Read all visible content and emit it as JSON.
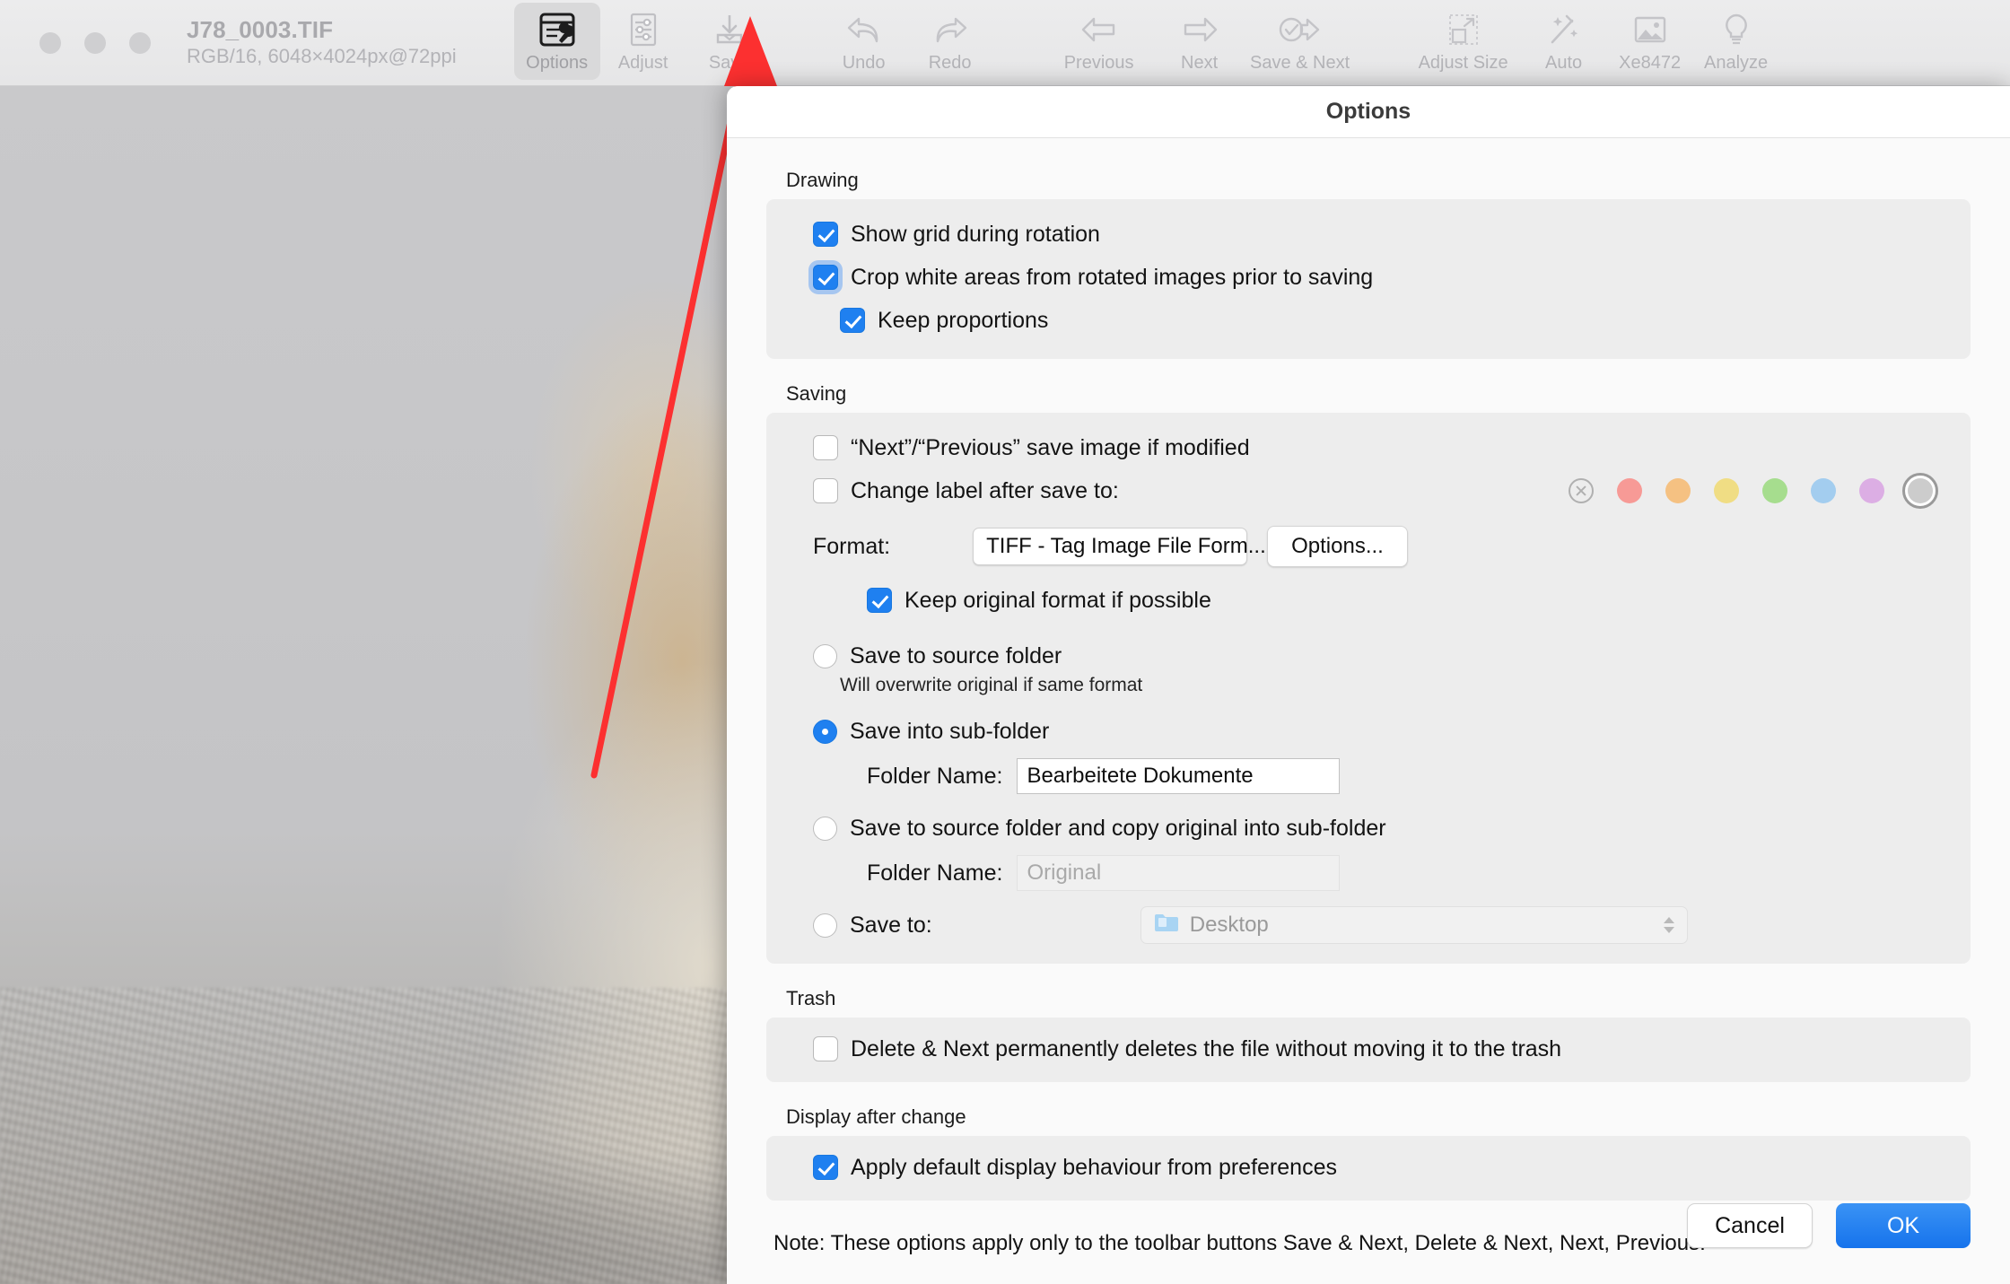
{
  "window": {
    "file_name": "J78_0003.TIF",
    "file_meta": "RGB/16, 6048×4024px@72ppi"
  },
  "toolbar": {
    "items": [
      {
        "label": "Options",
        "icon": "options-wrench-icon",
        "active": true
      },
      {
        "label": "Adjust",
        "icon": "sliders-icon",
        "active": false
      },
      {
        "label": "Save",
        "icon": "save-download-icon",
        "active": false
      },
      {
        "label": "Undo",
        "icon": "undo-arrow-icon",
        "active": false
      },
      {
        "label": "Redo",
        "icon": "redo-arrow-icon",
        "active": false
      },
      {
        "label": "Previous",
        "icon": "arrow-left-icon",
        "active": false
      },
      {
        "label": "Next",
        "icon": "arrow-right-icon",
        "active": false
      },
      {
        "label": "Save & Next",
        "icon": "check-arrow-icon",
        "active": false
      },
      {
        "label": "Adjust Size",
        "icon": "resize-icon",
        "active": false
      },
      {
        "label": "Auto",
        "icon": "magic-wand-icon",
        "active": false
      },
      {
        "label": "Xe8472",
        "icon": "photo-icon",
        "active": false
      },
      {
        "label": "Analyze",
        "icon": "lightbulb-icon",
        "active": false
      }
    ]
  },
  "dialog": {
    "title": "Options",
    "drawing": {
      "section_label": "Drawing",
      "show_grid": {
        "label": "Show grid during rotation",
        "checked": true
      },
      "crop_white": {
        "label": "Crop white areas from rotated images prior to saving",
        "checked": true,
        "focused": true
      },
      "keep_proportions": {
        "label": "Keep proportions",
        "checked": true
      }
    },
    "saving": {
      "section_label": "Saving",
      "next_prev_save": {
        "label": "“Next”/“Previous” save image if modified",
        "checked": false
      },
      "change_label": {
        "label": "Change label after save to:",
        "checked": false
      },
      "label_colors": [
        {
          "name": "no-label",
          "color": "none"
        },
        {
          "name": "red",
          "color": "#f79a96"
        },
        {
          "name": "orange",
          "color": "#f5c182"
        },
        {
          "name": "yellow",
          "color": "#f0dd84"
        },
        {
          "name": "green",
          "color": "#a6dd8e"
        },
        {
          "name": "blue",
          "color": "#a3cdef"
        },
        {
          "name": "purple",
          "color": "#dcaee4"
        },
        {
          "name": "gray",
          "color": "#cccccc",
          "selected": true
        }
      ],
      "format_label": "Format:",
      "format_value": "TIFF - Tag Image File Form...",
      "format_options_button": "Options...",
      "keep_original_format": {
        "label": "Keep original format if possible",
        "checked": true
      },
      "save_mode_selected": "sub_folder",
      "save_to_source": {
        "label": "Save to source folder",
        "hint": "Will overwrite original if same format"
      },
      "save_into_subfolder": {
        "label": "Save into sub-folder",
        "folder_name_label": "Folder Name:",
        "folder_name_value": "Bearbeitete Dokumente"
      },
      "save_source_and_copy": {
        "label": "Save to source folder and copy original into sub-folder",
        "folder_name_label": "Folder Name:",
        "folder_name_placeholder": "Original"
      },
      "save_to": {
        "label": "Save to:",
        "value": "Desktop"
      }
    },
    "trash": {
      "section_label": "Trash",
      "delete_permanently": {
        "label": "Delete & Next permanently deletes the file without moving it to the trash",
        "checked": false
      }
    },
    "display_after_change": {
      "section_label": "Display after change",
      "apply_default": {
        "label": "Apply default display behaviour from preferences",
        "checked": true
      }
    },
    "note": "Note: These options apply only to the toolbar buttons Save & Next, Delete & Next, Next, Previous.",
    "cancel_button": "Cancel",
    "ok_button": "OK"
  },
  "annotation": {
    "arrow_color": "#fc3030"
  }
}
